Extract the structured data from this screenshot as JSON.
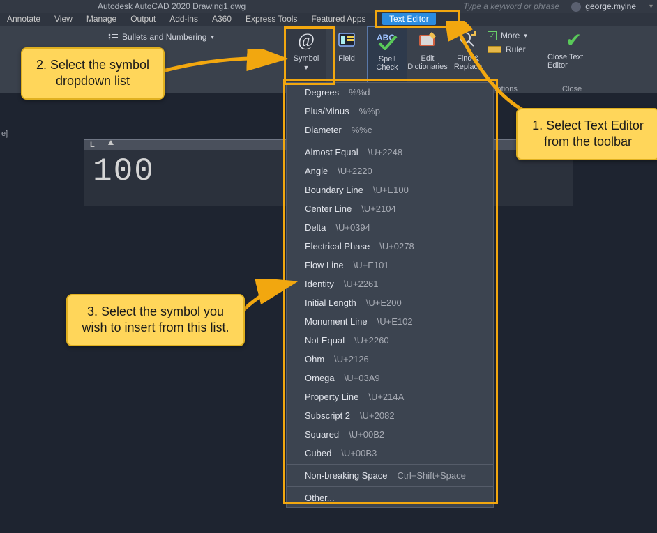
{
  "titlebar": {
    "app_title": "Autodesk AutoCAD 2020   Drawing1.dwg",
    "search_hint": "Type a keyword or phrase",
    "user_name": "george.myine"
  },
  "menubar": [
    "Annotate",
    "View",
    "Manage",
    "Output",
    "Add-ins",
    "A360",
    "Express Tools",
    "Featured Apps"
  ],
  "format_group": {
    "bullets": "Bullets and Numbering"
  },
  "tab_active": "Text Editor",
  "ribbon": {
    "symbol": "Symbol",
    "field": "Field",
    "spell": "Spell Check",
    "dict": "Edit Dictionaries",
    "find": "Find & Replace",
    "more": "More",
    "ruler": "Ruler",
    "options": "Options",
    "close": "Close Text Editor",
    "close_panel": "Close"
  },
  "status_left": "e]",
  "text_entry": "100",
  "symbol_menu": {
    "top": [
      {
        "label": "Degrees",
        "code": "%%d"
      },
      {
        "label": "Plus/Minus",
        "code": "%%p"
      },
      {
        "label": "Diameter",
        "code": "%%c"
      }
    ],
    "mid": [
      {
        "label": "Almost Equal",
        "code": "\\U+2248"
      },
      {
        "label": "Angle",
        "code": "\\U+2220"
      },
      {
        "label": "Boundary Line",
        "code": "\\U+E100"
      },
      {
        "label": "Center Line",
        "code": "\\U+2104"
      },
      {
        "label": "Delta",
        "code": "\\U+0394"
      },
      {
        "label": "Electrical Phase",
        "code": "\\U+0278"
      },
      {
        "label": "Flow Line",
        "code": "\\U+E101"
      },
      {
        "label": "Identity",
        "code": "\\U+2261"
      },
      {
        "label": "Initial Length",
        "code": "\\U+E200"
      },
      {
        "label": "Monument Line",
        "code": "\\U+E102"
      },
      {
        "label": "Not Equal",
        "code": "\\U+2260"
      },
      {
        "label": "Ohm",
        "code": "\\U+2126"
      },
      {
        "label": "Omega",
        "code": "\\U+03A9"
      },
      {
        "label": "Property Line",
        "code": "\\U+214A"
      },
      {
        "label": "Subscript 2",
        "code": "\\U+2082"
      },
      {
        "label": "Squared",
        "code": "\\U+00B2"
      },
      {
        "label": "Cubed",
        "code": "\\U+00B3"
      }
    ],
    "nbk": {
      "label": "Non-breaking Space",
      "code": "Ctrl+Shift+Space"
    },
    "other": "Other..."
  },
  "callouts": {
    "c1": "1. Select Text Editor from the toolbar",
    "c2": "2. Select the symbol dropdown list",
    "c3": "3. Select the symbol you wish to insert from this list."
  }
}
